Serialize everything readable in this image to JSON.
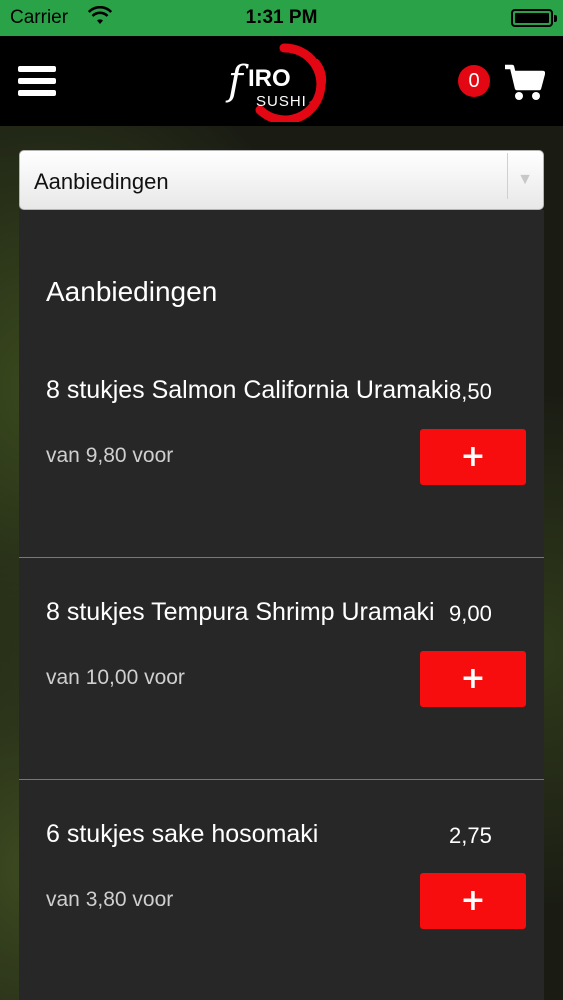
{
  "status_bar": {
    "carrier": "Carrier",
    "time": "1:31 PM",
    "battery_level": 1.0
  },
  "header": {
    "menu_icon": "hamburger-menu-icon",
    "logo": {
      "brand": "Hiro",
      "sub": "SUSHI"
    },
    "cart_count": "0",
    "cart_icon": "shopping-cart-icon"
  },
  "category_select": {
    "selected": "Aanbiedingen",
    "icon": "chevron-down-icon"
  },
  "section_title": "Aanbiedingen",
  "offers": [
    {
      "name": "8 stukjes Salmon California Uramaki",
      "price": "8,50",
      "old_price": "van 9,80 voor",
      "add_label": "+"
    },
    {
      "name": "8 stukjes Tempura Shrimp Uramaki",
      "price": "9,00",
      "old_price": "van 10,00 voor",
      "add_label": "+"
    },
    {
      "name": "6 stukjes sake hosomaki",
      "price": "2,75",
      "old_price": "van 3,80 voor",
      "add_label": "+"
    }
  ],
  "colors": {
    "status_bar": "#2aa348",
    "header": "#000000",
    "panel": "#272727",
    "accent_red": "#f70d0d"
  }
}
